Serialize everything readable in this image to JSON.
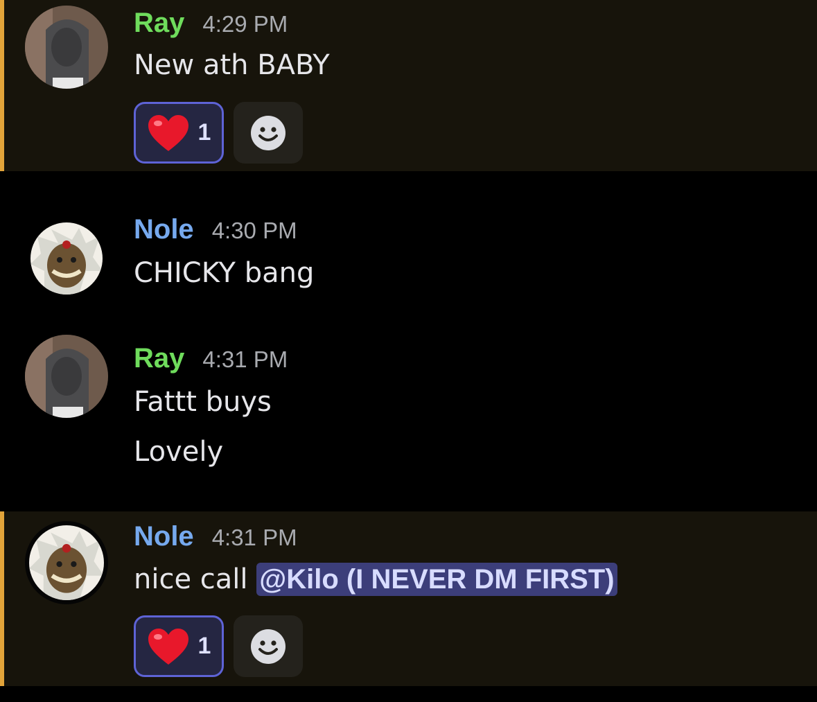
{
  "colors": {
    "ray_name": "#6fdc5c",
    "nole_name": "#76a9ee",
    "highlight_bar": "#e2a43a",
    "highlight_bg": "#17140b",
    "mention_bg": "#3c3e7a"
  },
  "messages": [
    {
      "author": "Ray",
      "timestamp": "4:29 PM",
      "lines": [
        "New ath BABY"
      ],
      "reaction": {
        "emoji": "heart",
        "count": "1"
      }
    },
    {
      "author": "Nole",
      "timestamp": "4:30 PM",
      "lines": [
        "CHICKY bang"
      ]
    },
    {
      "author": "Ray",
      "timestamp": "4:31 PM",
      "lines": [
        "Fattt buys",
        "Lovely"
      ]
    },
    {
      "author": "Nole",
      "timestamp": "4:31 PM",
      "text_prefix": "nice call ",
      "mention": "@Kilo (I NEVER DM FIRST)",
      "reaction": {
        "emoji": "heart",
        "count": "1"
      }
    }
  ]
}
